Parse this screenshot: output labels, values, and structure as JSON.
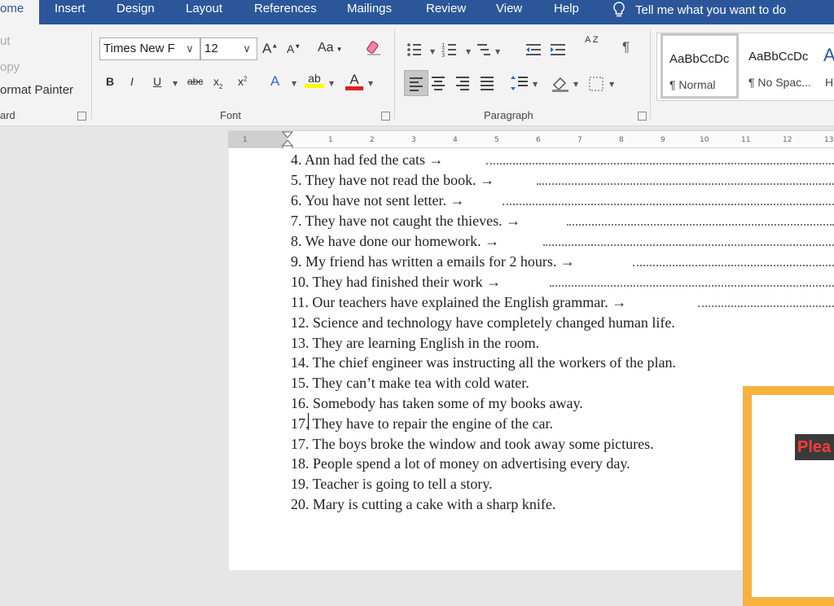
{
  "tabs": [
    "ome",
    "Insert",
    "Design",
    "Layout",
    "References",
    "Mailings",
    "Review",
    "View",
    "Help"
  ],
  "tell_me": "Tell me what you want to do",
  "clipboard": {
    "items": [
      "ut",
      "opy",
      "ormat Painter"
    ],
    "label": "ard"
  },
  "font_group": {
    "font_name": "Times New F",
    "font_size": "12",
    "grow": "A",
    "shrink": "A",
    "change_case": "Aa",
    "bold": "B",
    "italic": "I",
    "underline": "U",
    "strike": "abc",
    "subscript": "x",
    "superscript": "x",
    "effects": "A",
    "highlight": "ab",
    "font_color": "A",
    "label": "Font"
  },
  "paragraph_group": {
    "sort": "A Z",
    "pilcrow": "¶",
    "label": "Paragraph"
  },
  "styles": [
    {
      "sample": "AaBbCcDc",
      "name": "¶ Normal"
    },
    {
      "sample": "AaBbCcDc",
      "name": "¶ No Spac..."
    }
  ],
  "ruler_ticks": [
    "1",
    "1",
    "2",
    "3",
    "4",
    "5",
    "6",
    "7",
    "8",
    "9",
    "10",
    "11",
    "12",
    "13"
  ],
  "document_lines": [
    "4. Ann had fed the cats  →",
    "5. They have not read the book. →",
    "6. You have not sent letter. →",
    "7. They have not caught the thieves. →",
    "8. We have done our homework. →",
    "9. My friend has written a emails for 2 hours. →",
    "10. They had finished their work  →",
    "11. Our teachers have explained the English grammar. →",
    "12. Science and technology have completely changed human life.",
    "13. They are learning English in the room.",
    "14. The chief engineer was instructing all the workers of the plan.",
    "15. They can’t make tea with cold water.",
    "16. Somebody has taken some of my books away.",
    "17. They have to repair the engine of the car.",
    "17. The boys broke the window and took away some pictures.",
    "18. People spend a lot of money on advertising every day.",
    "19. Teacher is going to tell a story.",
    "20. Mary is cutting a cake with a sharp knife."
  ],
  "overlay_label": "Plea",
  "colors": {
    "ribbon_blue": "#2b579a",
    "frame_orange": "#f6b23d",
    "highlight_yellow": "#ffff00",
    "font_red": "#e02020"
  }
}
